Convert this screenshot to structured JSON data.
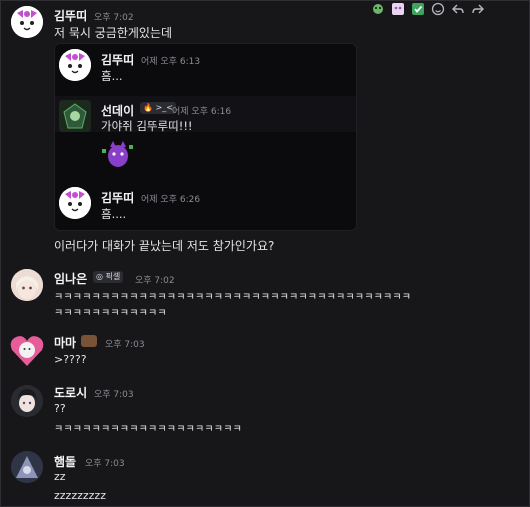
{
  "toolbar": {
    "icons": [
      "react-emoji-icon",
      "sticker-icon",
      "checkmark-icon",
      "add-reaction-icon",
      "reply-icon",
      "forward-icon"
    ]
  },
  "messages": [
    {
      "author": "김뚜띠",
      "time": "오후 7:02",
      "text": "저 묵시 궁금한게있는데"
    },
    {
      "author": "임나은",
      "badge": "◎ 픽셀",
      "time": "오후 7:02",
      "lines": [
        "ㅋㅋㅋㅋㅋㅋㅋㅋㅋㅋㅋㅋㅋㅋㅋㅋㅋㅋㅋㅋㅋㅋㅋㅋㅋㅋㅋㅋㅋㅋㅋㅋㅋㅋㅋㅋㅋㅋ",
        "ㅋㅋㅋㅋㅋㅋㅋㅋㅋㅋㅋㅋ"
      ]
    },
    {
      "author": "마마",
      "time": "오후 7:03",
      "text": ">????"
    },
    {
      "author": "도로시",
      "time": "오후 7:03",
      "lines": [
        "??",
        "ㅋㅋㅋㅋㅋㅋㅋㅋㅋㅋㅋㅋㅋㅋㅋㅋㅋㅋㅋㅋ"
      ]
    },
    {
      "author": "햄돌",
      "time": "오후 7:03",
      "lines": [
        "zz",
        "zzzzzzzzz"
      ]
    }
  ],
  "followup_text": "이러다가 대화가 끝났는데 저도 참가인가요?",
  "embed": {
    "items": [
      {
        "author": "김뚜띠",
        "time": "어제 오후 6:13",
        "text": "흠..."
      },
      {
        "author": "선데이",
        "badge": "🔥 >_<",
        "time": "어제 오후 6:16",
        "text": "가야쥐 김뚜루띠!!!"
      },
      {
        "author": "김뚜띠",
        "time": "어제 오후 6:26",
        "text": "흠...."
      }
    ]
  },
  "colors": {
    "background": "#17171a",
    "embed_background": "#0b0b0e",
    "name": "#f2f3f5",
    "time": "#8b8d93"
  }
}
